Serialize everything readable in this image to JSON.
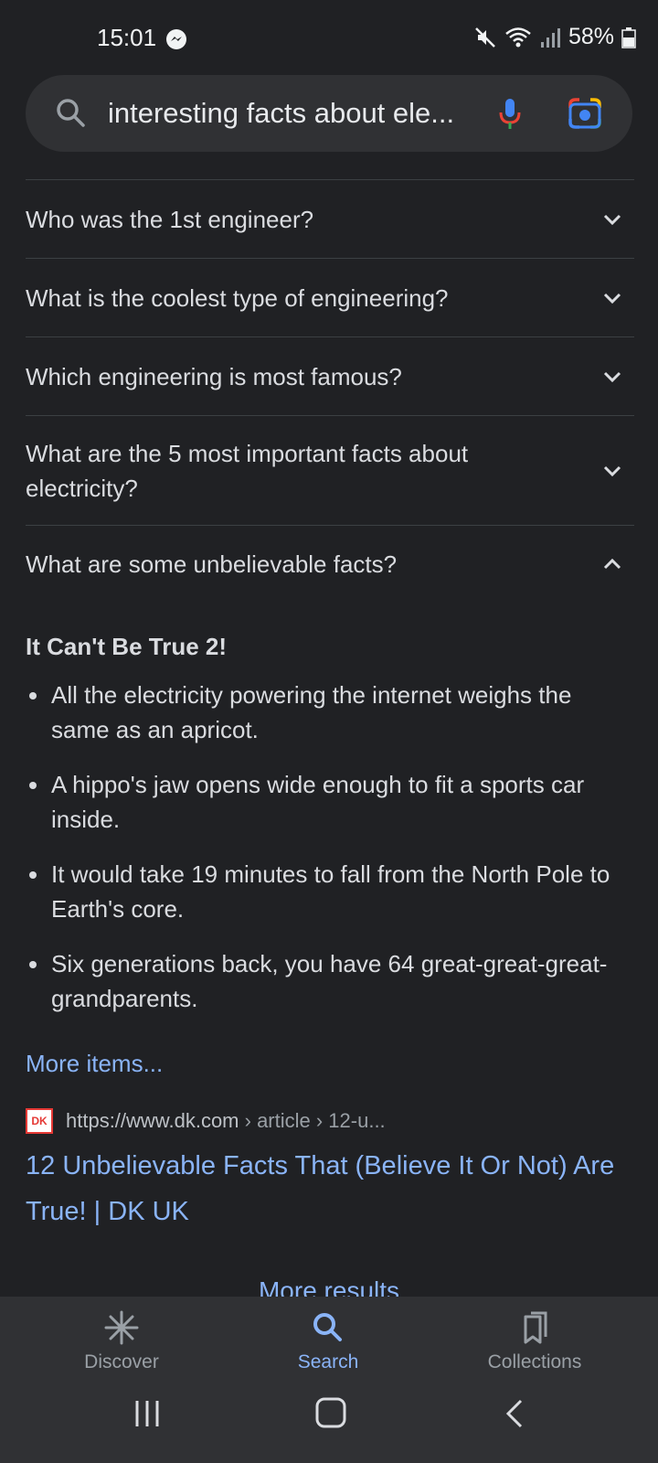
{
  "status": {
    "time": "15:01",
    "battery": "58%"
  },
  "search": {
    "query": "interesting facts about ele..."
  },
  "questions": [
    {
      "text": "Who was the 1st engineer?",
      "expanded": false
    },
    {
      "text": "What is the coolest type of engineering?",
      "expanded": false
    },
    {
      "text": "Which engineering is most famous?",
      "expanded": false
    },
    {
      "text": "What are the 5 most important facts about electricity?",
      "expanded": false
    },
    {
      "text": "What are some unbelievable facts?",
      "expanded": true
    }
  ],
  "answer": {
    "title": "It Can't Be True 2!",
    "bullets": [
      "All the electricity powering the internet weighs the same as an apricot.",
      "A hippo's jaw opens wide enough to fit a sports car inside.",
      "It would take 19 minutes to fall from the North Pole to Earth's core.",
      "Six generations back, you have 64 great-great-great-grandparents."
    ],
    "more_items": "More items..."
  },
  "source": {
    "logo": "DK",
    "url": "https://www.dk.com",
    "path": " › article › 12-u...",
    "title": "12 Unbelievable Facts That (Believe It Or Not) Are True! | DK UK"
  },
  "more_results": "More results",
  "bottom_nav": {
    "discover": "Discover",
    "search": "Search",
    "collections": "Collections"
  },
  "colors": {
    "background": "#202124",
    "link": "#8ab4f8",
    "surface": "#303134"
  }
}
